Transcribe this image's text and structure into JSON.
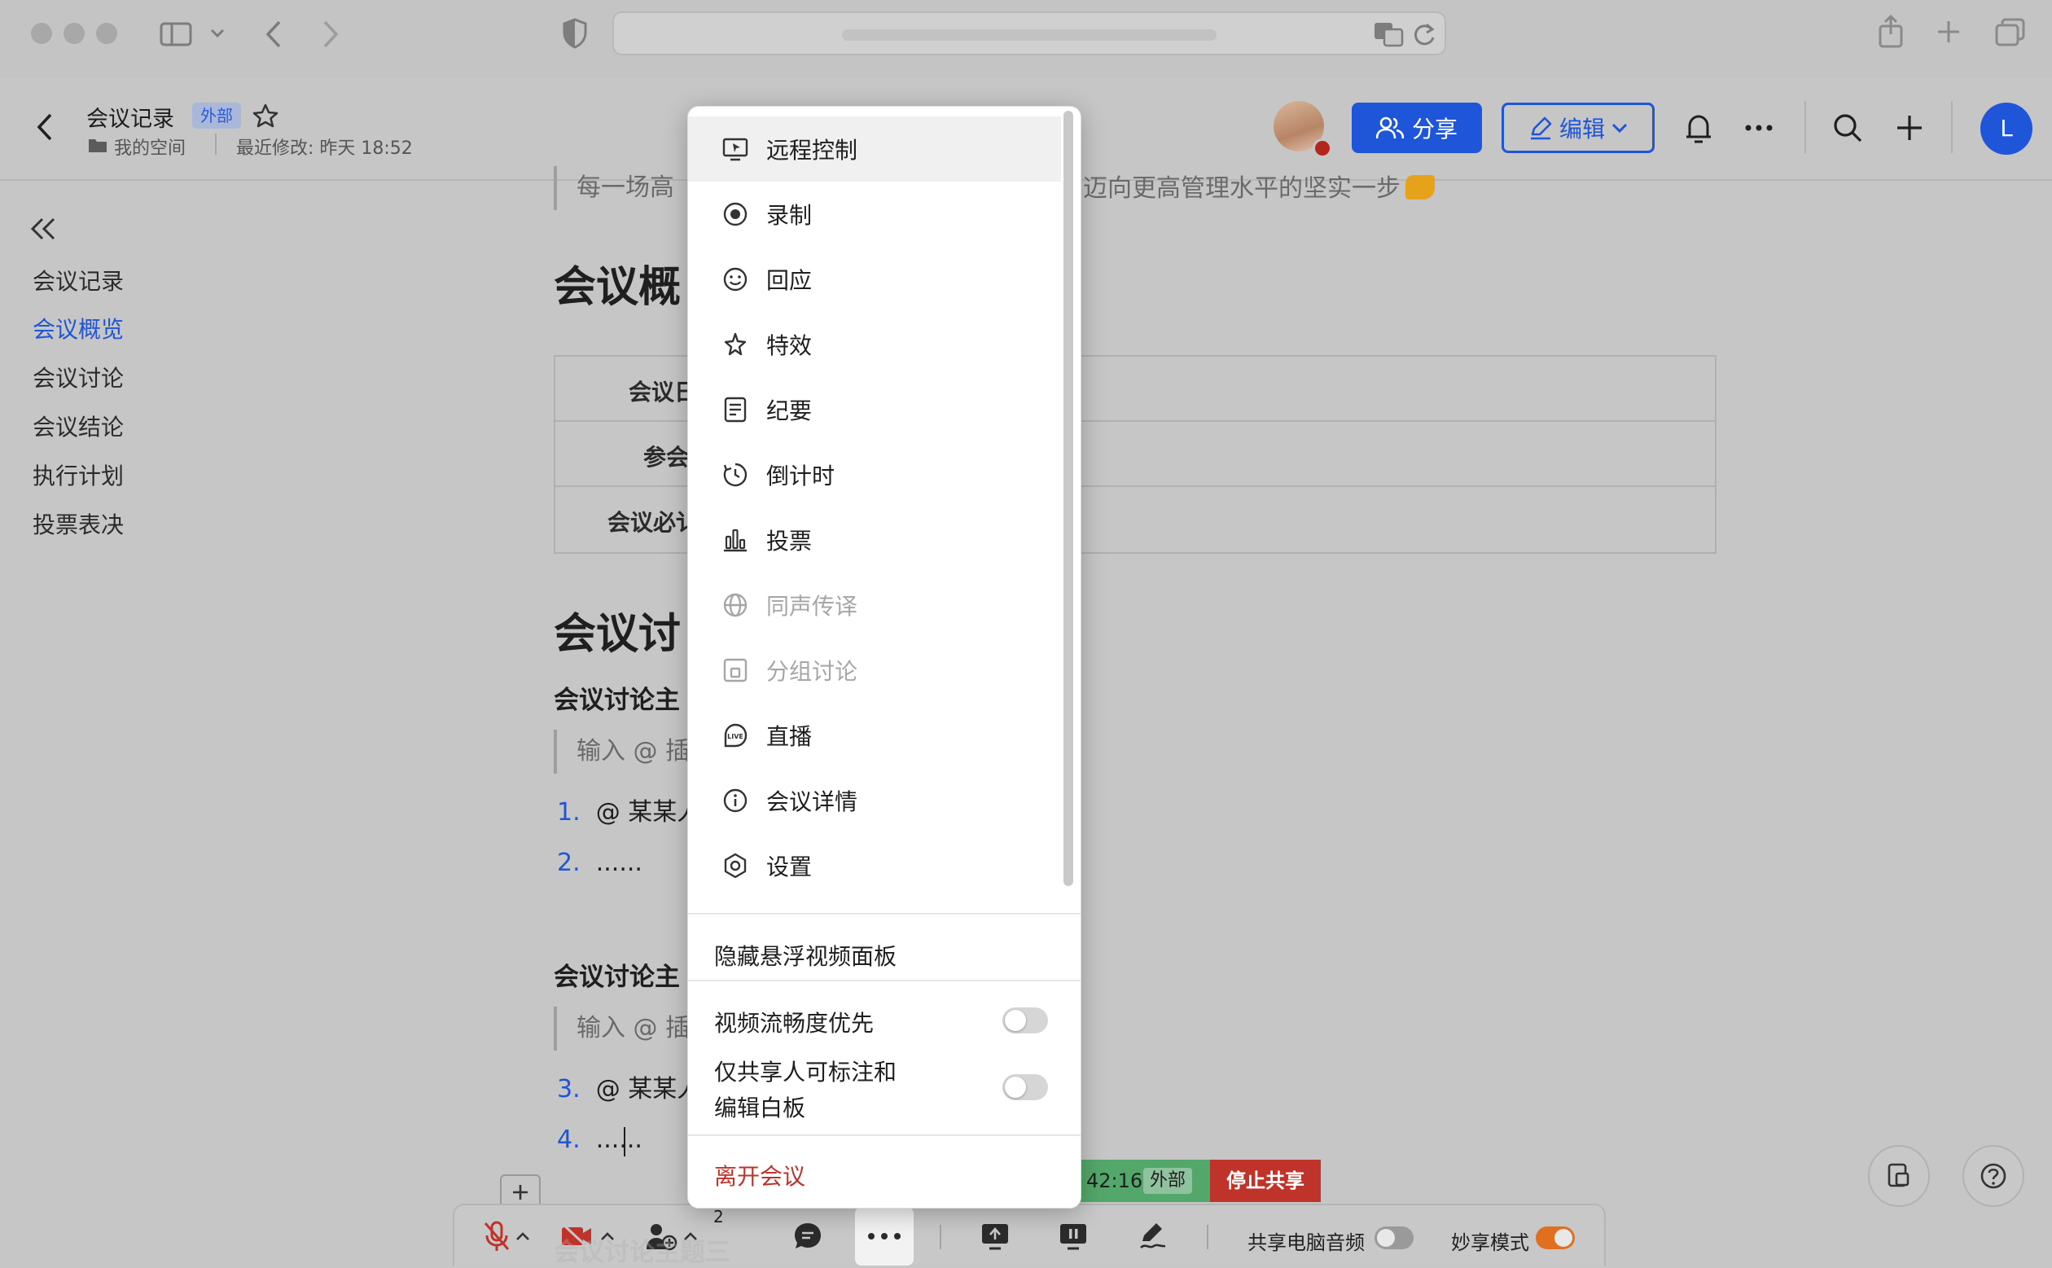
{
  "doc": {
    "title": "会议记录",
    "external_badge": "外部",
    "space": "我的空间",
    "last_modified": "最近修改: 昨天 18:52",
    "share_label": "分享",
    "edit_label": "编辑",
    "user_initial": "L"
  },
  "outline": {
    "items": [
      "会议记录",
      "会议概览",
      "会议讨论",
      "会议结论",
      "执行计划",
      "投票表决"
    ],
    "active_index": 1
  },
  "body": {
    "quote_top": "每一场高",
    "quote_top_right": "迈向更高管理水平的坚实一步",
    "overview_heading": "会议概",
    "table_rows": [
      "会议日",
      "参会",
      "会议必讠"
    ],
    "discussion_heading": "会议讨",
    "topic1": "会议讨论主",
    "topic2": "会议讨论主",
    "input_hint": "输入 @ 插",
    "list": [
      {
        "num": "1.",
        "text": "@ 某某人"
      },
      {
        "num": "2.",
        "text": "......"
      },
      {
        "num": "3.",
        "text": "@ 某某人"
      },
      {
        "num": "4.",
        "text": "......"
      }
    ],
    "bottom_faded": "会议讨论主题三"
  },
  "menu": {
    "items": [
      {
        "label": "远程控制",
        "icon": "remote-control-icon",
        "disabled": false
      },
      {
        "label": "录制",
        "icon": "record-icon",
        "disabled": false
      },
      {
        "label": "回应",
        "icon": "reaction-icon",
        "disabled": false
      },
      {
        "label": "特效",
        "icon": "effects-icon",
        "disabled": false
      },
      {
        "label": "纪要",
        "icon": "minutes-icon",
        "disabled": false
      },
      {
        "label": "倒计时",
        "icon": "countdown-icon",
        "disabled": false
      },
      {
        "label": "投票",
        "icon": "vote-icon",
        "disabled": false
      },
      {
        "label": "同声传译",
        "icon": "interpretation-icon",
        "disabled": true
      },
      {
        "label": "分组讨论",
        "icon": "breakout-icon",
        "disabled": true
      },
      {
        "label": "直播",
        "icon": "live-icon",
        "disabled": false
      },
      {
        "label": "会议详情",
        "icon": "info-icon",
        "disabled": false
      },
      {
        "label": "设置",
        "icon": "settings-icon",
        "disabled": false
      }
    ],
    "hide_panel": "隐藏悬浮视频面板",
    "video_smooth": "视频流畅度优先",
    "annotate_only_line1": "仅共享人可标注和",
    "annotate_only_line2": "编辑白板",
    "leave": "离开会议"
  },
  "share_bar": {
    "time": "42:16",
    "external": "外部",
    "stop": "停止共享"
  },
  "toolbar": {
    "participants_count": "2",
    "share_audio": "共享电脑音频",
    "smart_share": "妙享模式"
  },
  "colors": {
    "accent": "#1f55d8",
    "danger": "#c0332b",
    "share_green": "#54a76b"
  }
}
